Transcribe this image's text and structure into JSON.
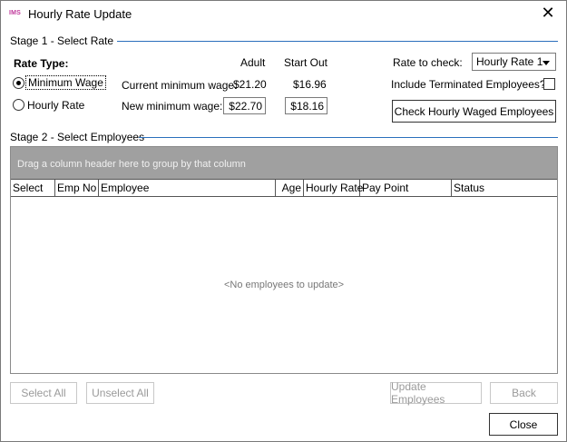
{
  "window": {
    "app_icon_text": "IMS",
    "title": "Hourly Rate Update",
    "close_glyph": "✕"
  },
  "stage1": {
    "title": "Stage 1 - Select Rate",
    "rate_type_label": "Rate Type:",
    "options": [
      "Minimum Wage",
      "Hourly Rate"
    ],
    "selected_option": "Minimum Wage",
    "col_adult": "Adult",
    "col_start_out": "Start Out",
    "current_label": "Current minimum wage:",
    "current_adult": "$21.20",
    "current_start_out": "$16.96",
    "new_label": "New minimum wage:",
    "new_adult": "$22.70",
    "new_start_out": "$18.16",
    "rate_to_check_label": "Rate to check:",
    "rate_to_check_value": "Hourly Rate 1",
    "include_terminated_label": "Include Terminated Employees?:",
    "include_terminated_checked": false,
    "check_button": "Check Hourly Waged Employees"
  },
  "stage2": {
    "title": "Stage 2 - Select Employees",
    "group_hint": "Drag a column header here to group by that column",
    "columns": [
      "Select",
      "Emp No",
      "Employee",
      "Age",
      "Hourly Rate",
      "Pay Point",
      "Status"
    ],
    "empty_text": "<No employees to update>"
  },
  "buttons": {
    "select_all": "Select All",
    "unselect_all": "Unselect All",
    "update_employees": "Update Employees",
    "back": "Back",
    "close": "Close"
  }
}
